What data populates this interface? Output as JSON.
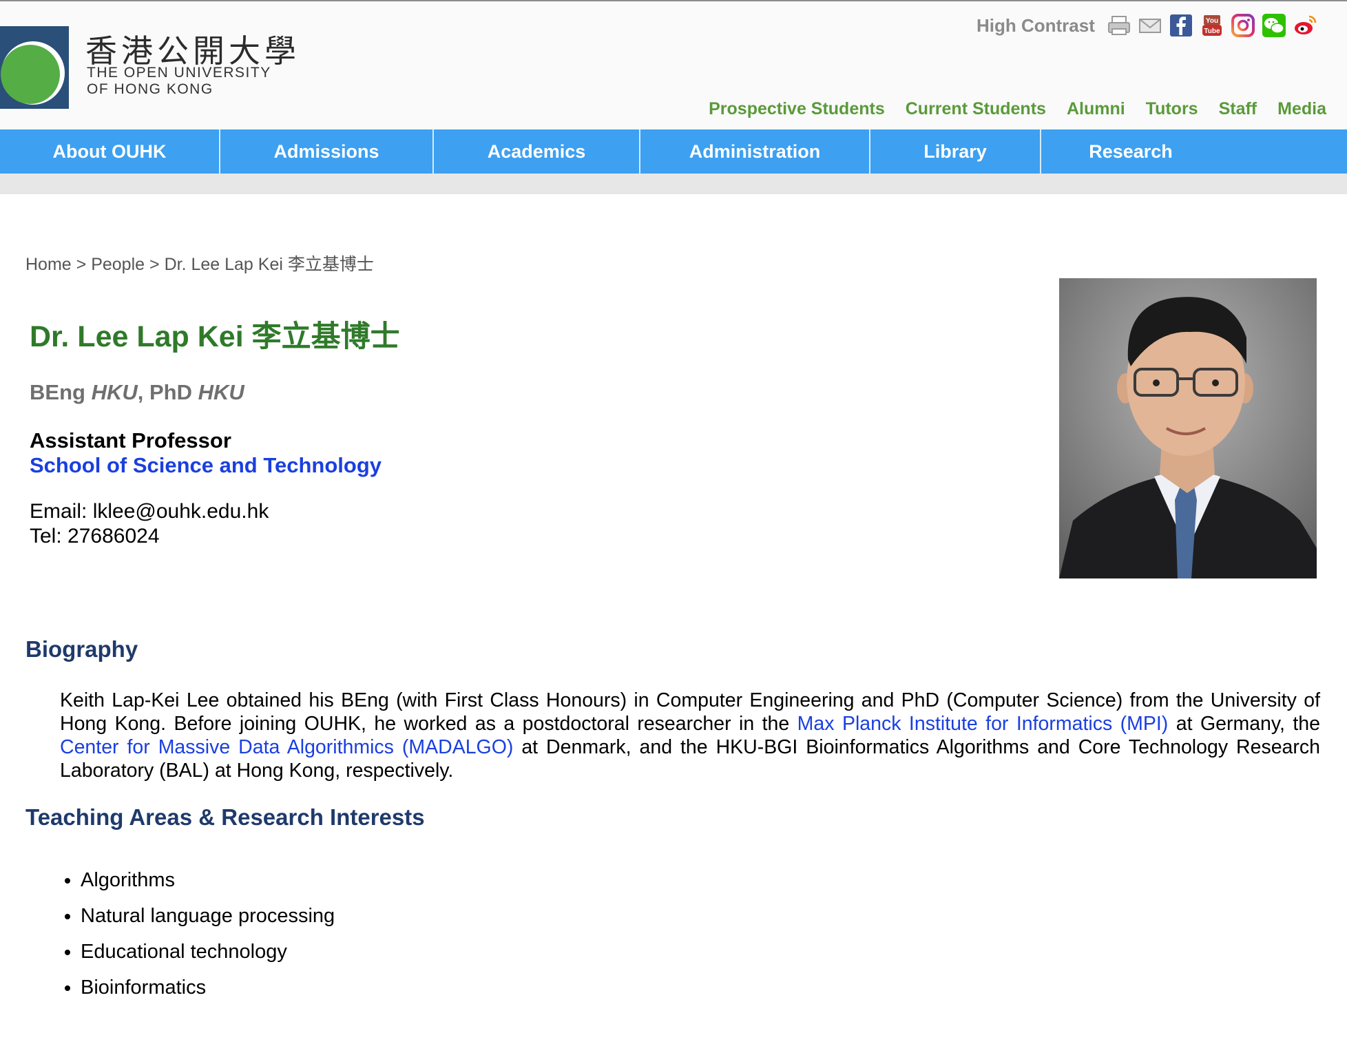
{
  "logo": {
    "zh": "香港公開大學",
    "en_line1": "THE OPEN UNIVERSITY",
    "en_line2": "OF HONG KONG"
  },
  "utility": {
    "high_contrast": "High Contrast",
    "icons": [
      "printer-icon",
      "mail-icon",
      "facebook-icon",
      "youtube-icon",
      "instagram-icon",
      "wechat-icon",
      "weibo-icon"
    ]
  },
  "audience_links": [
    "Prospective Students",
    "Current Students",
    "Alumni",
    "Tutors",
    "Staff",
    "Media"
  ],
  "nav": [
    "About OUHK",
    "Admissions",
    "Academics",
    "Administration",
    "Library",
    "Research"
  ],
  "breadcrumb": {
    "home": "Home",
    "sep": ">",
    "people": "People",
    "current": "Dr. Lee Lap Kei 李立基博士"
  },
  "profile": {
    "name": "Dr. Lee Lap Kei 李立基博士",
    "degree1": "BEng",
    "degree1_inst": "HKU",
    "degree2": "PhD",
    "degree2_inst": "HKU",
    "position": "Assistant Professor",
    "school": "School of Science and Technology",
    "email_label": "Email:",
    "email": "lklee@ouhk.edu.hk",
    "tel_label": "Tel:",
    "tel": "27686024"
  },
  "biography": {
    "heading": "Biography",
    "text1": "Keith Lap-Kei Lee obtained his BEng (with First Class Honours) in Computer Engineering and PhD (Computer Science) from the University of Hong Kong. Before joining OUHK, he worked as a postdoctoral researcher in the ",
    "link1": "Max Planck Institute for Informatics (MPI)",
    "text2": " at Germany, the ",
    "link2": "Center for Massive Data Algorithmics (MADALGO)",
    "text3": " at Denmark, and the HKU-BGI Bioinformatics Algorithms and Core Technology Research Laboratory (BAL) at Hong Kong, respectively."
  },
  "interests": {
    "heading": "Teaching Areas & Research Interests",
    "items": [
      "Algorithms",
      "Natural language processing",
      "Educational technology",
      "Bioinformatics"
    ]
  },
  "colors": {
    "nav_bg": "#3da0f0",
    "name_green": "#2f7a2a",
    "audience_green": "#5a9a3a",
    "heading_navy": "#1f3a6b",
    "link_blue": "#1a3fe0"
  }
}
